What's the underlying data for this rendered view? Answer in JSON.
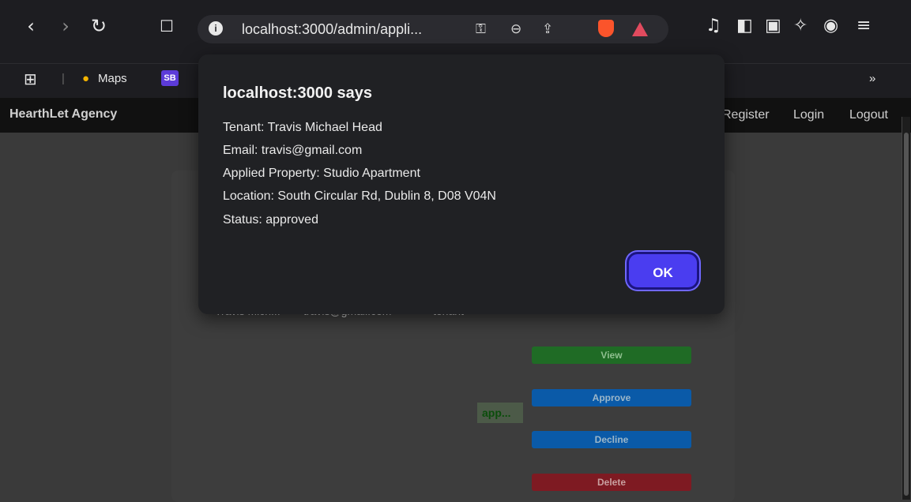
{
  "browser": {
    "url": "localhost:3000/admin/appli...",
    "bookmarks": [
      "Maps",
      "SB"
    ],
    "bookmark_sb_badge": "SB",
    "overflow": "»"
  },
  "navbar": {
    "brand": "HearthLet Agency",
    "links": [
      "Register",
      "Login",
      "Logout"
    ]
  },
  "table_row": {
    "name": "Travis Mich...",
    "email": "travis@gmail.com",
    "role": "tenant",
    "status": "app..."
  },
  "actions": {
    "view": "View",
    "approve": "Approve",
    "decline": "Decline",
    "delete": "Delete"
  },
  "dialog": {
    "title": "localhost:3000 says",
    "lines": [
      "Tenant: Travis Michael Head",
      "Email: travis@gmail.com",
      "Applied Property: Studio Apartment",
      "Location: South Circular Rd, Dublin 8, D08 V04N",
      "Status: approved"
    ],
    "ok_label": "OK"
  },
  "colors": {
    "view_btn": "#1f6b25",
    "approve_btn": "#0a5aa8",
    "decline_btn": "#0a5aa8",
    "delete_btn": "#7e1a22",
    "ok_btn": "#4a3df0"
  }
}
